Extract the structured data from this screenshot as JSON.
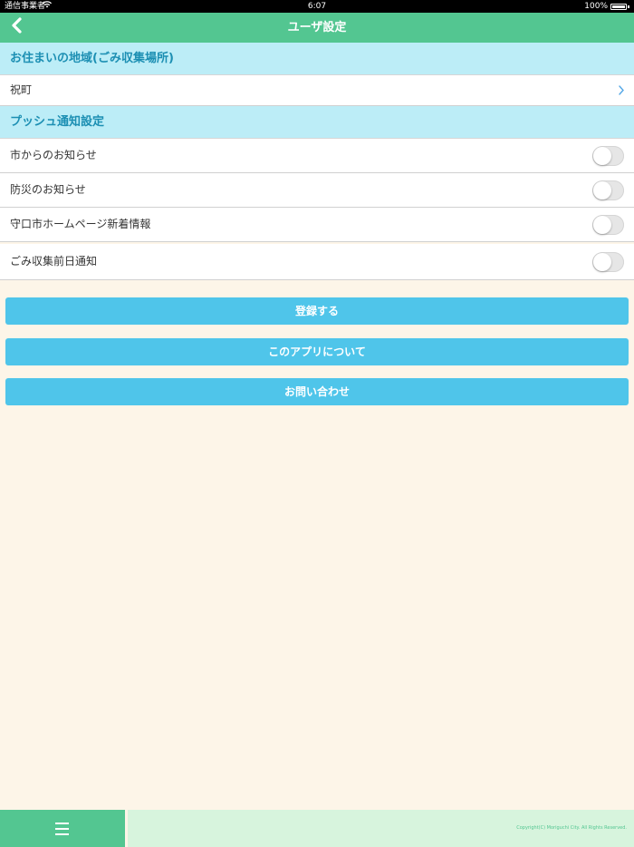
{
  "status": {
    "carrier": "通信事業者",
    "time": "6:07",
    "battery": "100%"
  },
  "header": {
    "title": "ユーザ設定"
  },
  "region": {
    "header": "お住まいの地域(ごみ収集場所)",
    "value": "祝町"
  },
  "push": {
    "header": "プッシュ通知設定",
    "items": [
      {
        "label": "市からのお知らせ",
        "enabled": false
      },
      {
        "label": "防災のお知らせ",
        "enabled": false
      },
      {
        "label": "守口市ホームページ新着情報",
        "enabled": false
      },
      {
        "label": "ごみ収集前日通知",
        "enabled": false
      }
    ]
  },
  "buttons": {
    "register": "登録する",
    "about": "このアプリについて",
    "contact": "お問い合わせ"
  },
  "footer": {
    "copyright": "Copyright(C) Moriguchi City. All Rights Reserved."
  },
  "colors": {
    "nav": "#53c691",
    "section": "#bcedf7",
    "button": "#4fc5ea",
    "background": "#fdf5e8"
  }
}
